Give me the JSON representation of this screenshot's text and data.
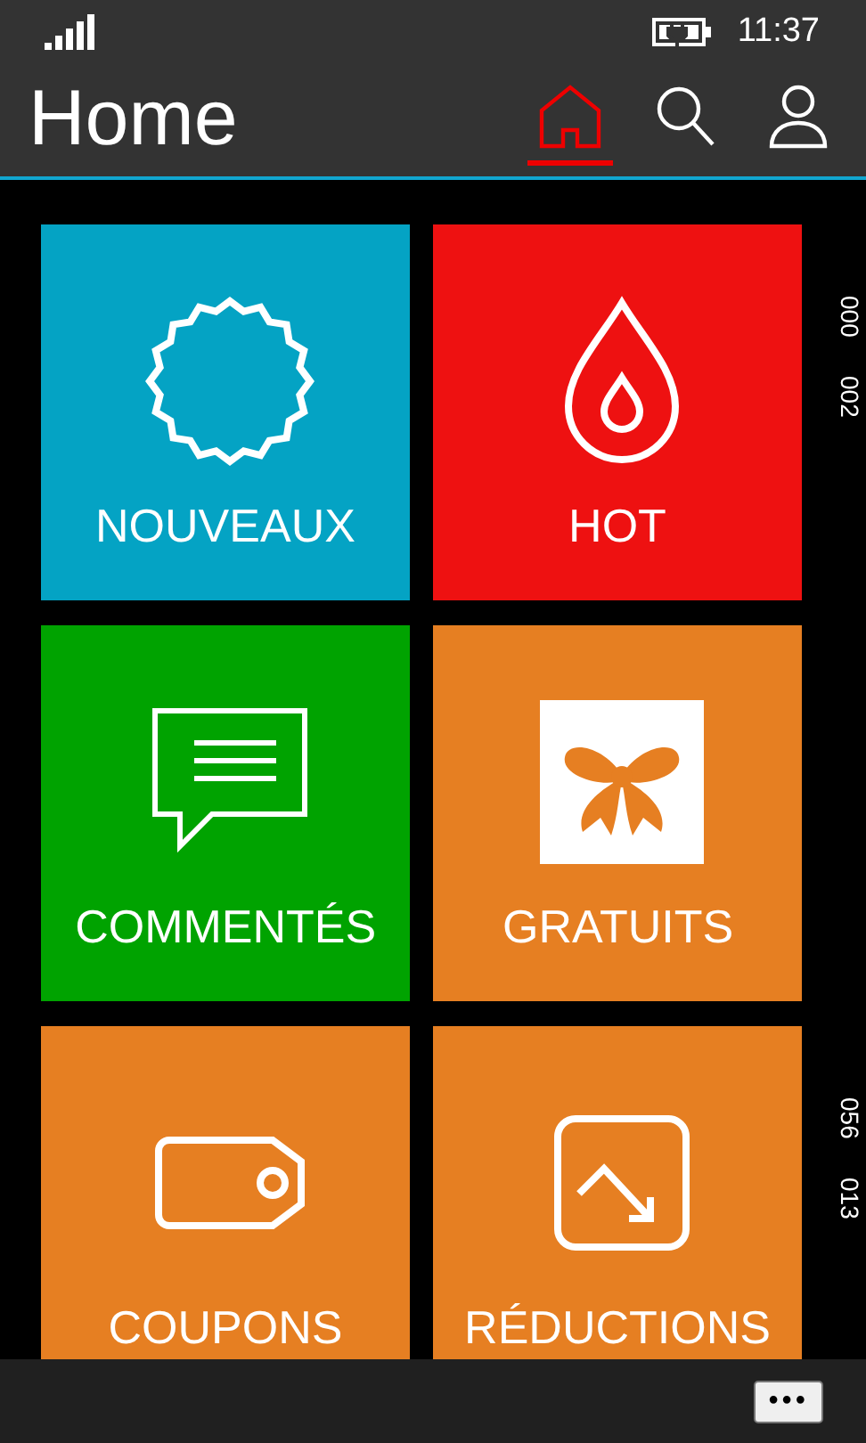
{
  "status_bar": {
    "time": "11:37"
  },
  "header": {
    "title": "Home",
    "nav": [
      {
        "kind": "home",
        "selected": true
      },
      {
        "kind": "search",
        "selected": false
      },
      {
        "kind": "profile",
        "selected": false
      }
    ]
  },
  "rows": [
    {
      "tiles": [
        {
          "label": "NOUVEAUX",
          "kind": "badge",
          "color": "#04a3c4"
        },
        {
          "label": "HOT",
          "kind": "drop",
          "color": "#ee1111"
        }
      ],
      "counts": [
        "000",
        "002"
      ]
    },
    {
      "tiles": [
        {
          "label": "COMMENTÉS",
          "kind": "chat",
          "color": "#00a300"
        },
        {
          "label": "GRATUITS",
          "kind": "bow",
          "color": "#e67f22"
        }
      ],
      "counts": []
    },
    {
      "tiles": [
        {
          "label": "COUPONS",
          "kind": "tag",
          "color": "#e67f22"
        },
        {
          "label": "RÉDUCTIONS",
          "kind": "discount",
          "color": "#e67f22"
        }
      ],
      "counts": [
        "056",
        "013"
      ]
    }
  ],
  "app_bar": {
    "more": "•••"
  }
}
